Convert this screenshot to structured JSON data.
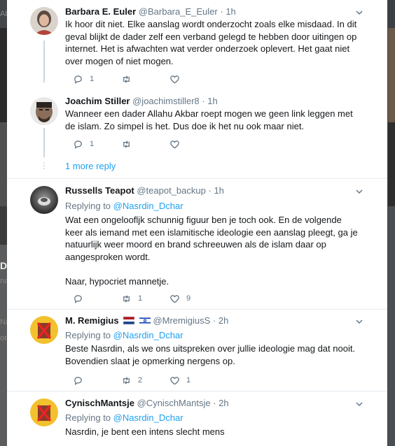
{
  "background": {
    "left_fragments": [
      "Ab",
      "De",
      "na",
      "Na",
      "ote"
    ]
  },
  "tweets": [
    {
      "name": "Barbara E. Euler",
      "handle": "@Barbara_E_Euler",
      "dot": "·",
      "time": "1h",
      "paragraphs": [
        "Ik hoor dit niet. Elke aanslag wordt onderzocht zoals elke misdaad. In dit geval blijkt de dader zelf een verband gelegd te hebben door uitingen op internet. Het is afwachten wat verder onderzoek oplevert. Het gaat niet over mogen of niet mogen."
      ],
      "reply_count": "1",
      "retweet_count": "",
      "like_count": ""
    },
    {
      "name": "Joachim Stiller",
      "handle": "@joachimstiller8",
      "dot": "·",
      "time": "1h",
      "paragraphs": [
        "Wanneer een dader Allahu Akbar roept mogen we geen link leggen met de islam. Zo simpel is het. Dus doe ik het nu ook maar niet."
      ],
      "reply_count": "1",
      "retweet_count": "",
      "like_count": ""
    },
    {
      "name": "Russells Teapot",
      "handle": "@teapot_backup",
      "dot": "·",
      "time": "1h",
      "replying_prefix": "Replying to",
      "replying_to": "@Nasrdin_Dchar",
      "paragraphs": [
        "Wat een ongeloofljk schunnig figuur ben je toch ook. En de volgende keer als iemand met een islamitische ideologie een aanslag pleegt, ga je natuurlijk weer moord en brand schreeuwen als de islam daar op aangesproken wordt.",
        "Naar, hypocriet mannetje."
      ],
      "reply_count": "",
      "retweet_count": "1",
      "like_count": "9"
    },
    {
      "name": "M. Remigius",
      "handle": "@MremigiusS",
      "dot": "·",
      "time": "2h",
      "replying_prefix": "Replying to",
      "replying_to": "@Nasrdin_Dchar",
      "paragraphs": [
        "Beste Nasrdin, als we ons uitspreken over jullie ideologie mag dat nooit. Bovendien slaat je opmerking nergens op."
      ],
      "reply_count": "",
      "retweet_count": "2",
      "like_count": "1"
    },
    {
      "name": "CynischMantsje",
      "handle": "@CynischMantsje",
      "dot": "·",
      "time": "2h",
      "replying_prefix": "Replying to",
      "replying_to": "@Nasrdin_Dchar",
      "paragraphs": [
        "Nasrdin, je bent een intens slecht mens"
      ]
    }
  ],
  "more_replies_label": "1 more reply",
  "colors": {
    "accent": "#1da1f2",
    "muted": "#657786",
    "text": "#14171a",
    "divider": "#e6ecf0",
    "thread": "#ccd6dd"
  }
}
